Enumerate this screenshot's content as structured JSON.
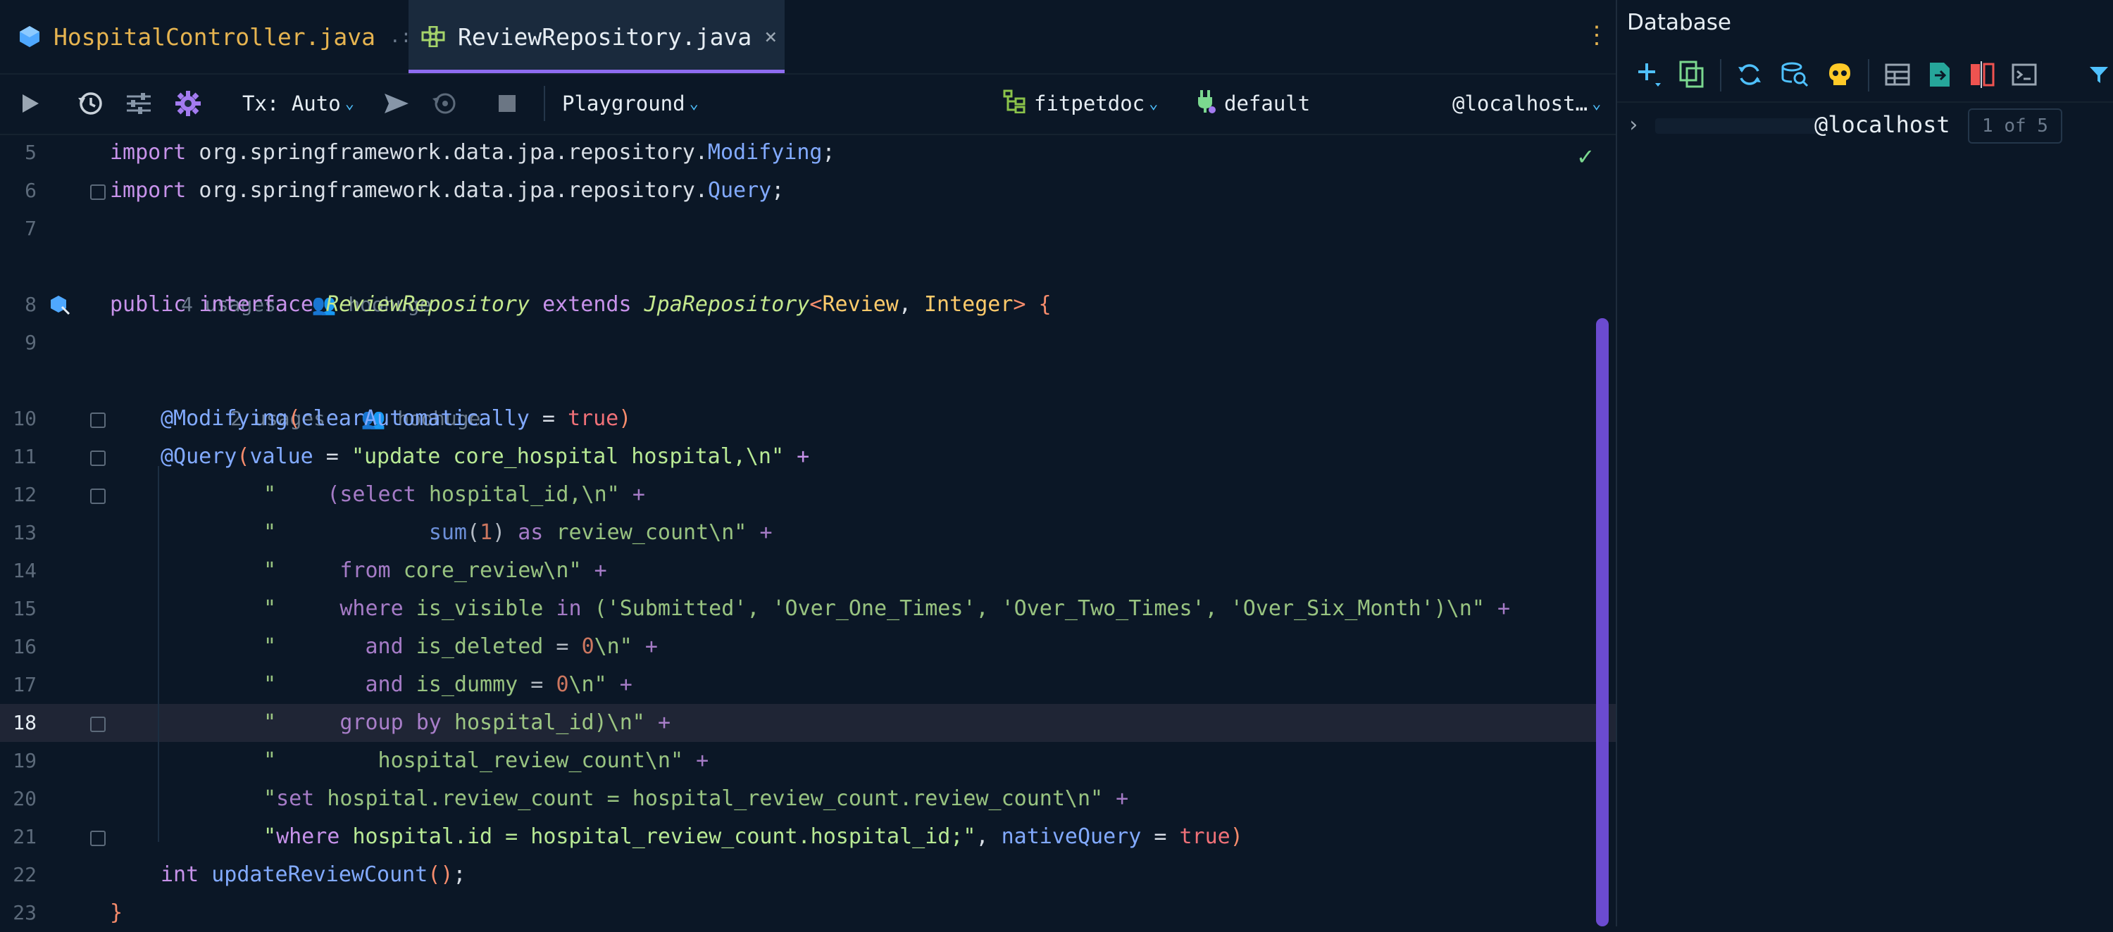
{
  "tabs": [
    {
      "label": "HospitalController.java",
      "marker": ".:"
    },
    {
      "label": "ReviewRepository.java",
      "close": "×"
    }
  ],
  "toolbar": {
    "tx_label": "Tx: Auto",
    "playground": "Playground",
    "schema": "fitpetdoc",
    "datasource": "default",
    "host": "@localhost…"
  },
  "code": {
    "line_numbers": [
      "5",
      "6",
      "7",
      "8",
      "9",
      "10",
      "11",
      "12",
      "13",
      "14",
      "15",
      "16",
      "17",
      "18",
      "19",
      "20",
      "21",
      "22",
      "23"
    ],
    "usages_1": "4 usages",
    "author_1": "hoohuge",
    "usages_2": "2 usages",
    "author_2": "hoohuge"
  },
  "database": {
    "title": "Database",
    "tree_label": "@localhost",
    "tree_badge": "1 of 5"
  },
  "colors": {
    "accent": "#8e6cf0",
    "background": "#0b1726",
    "current_line": "#1f2535"
  }
}
